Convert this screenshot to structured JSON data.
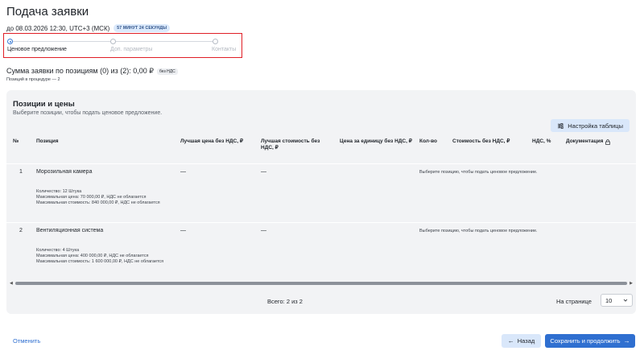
{
  "page": {
    "title": "Подача заявки",
    "deadline": "до 08.03.2026 12:30, UTC+3 (МСК)",
    "timer": "57 МИНУТ 24 СЕКУНДЫ"
  },
  "stepper": {
    "steps": [
      {
        "label": "Ценовое предложение",
        "active": true
      },
      {
        "label": "Доп. параметры",
        "active": false
      },
      {
        "label": "Контакты",
        "active": false
      }
    ]
  },
  "summary": {
    "text": "Сумма заявки по позициям (0) из (2): 0,00 ₽",
    "vat_badge": "без НДС",
    "positions_count": "Позиций в процедуре — 2"
  },
  "positions": {
    "title": "Позиции и цены",
    "subtitle": "Выберите позиции, чтобы подать ценовое предложение.",
    "settings_button": "Настройка таблицы",
    "columns": [
      "№",
      "Позиция",
      "Лучшая цена без НДС, ₽",
      "Лучшая стоимость без НДС, ₽",
      "Цена за единицу без НДС, ₽",
      "Кол-во",
      "Стоимость без НДС, ₽",
      "НДС, %",
      "Документация"
    ],
    "rows": [
      {
        "num": "1",
        "name": "Морозильная камера",
        "best_price": "—",
        "best_cost": "—",
        "hint": "Выберите позицию, чтобы подать ценовое предложение.",
        "details": [
          "Количество: 12 Штука",
          "Максимальная цена: 70 000,00 ₽, НДС не облагается",
          "Максимальная стоимость: 840 000,00 ₽, НДС не облагается"
        ]
      },
      {
        "num": "2",
        "name": "Вентиляционная система",
        "best_price": "—",
        "best_cost": "—",
        "hint": "Выберите позицию, чтобы подать ценовое предложение.",
        "details": [
          "Количество: 4 Штука",
          "Максимальная цена: 400 000,00 ₽, НДС не облагается",
          "Максимальная стоимость: 1 600 000,00 ₽, НДС не облагается"
        ]
      }
    ],
    "total": "Всего: 2 из 2",
    "per_page_label": "На странице",
    "per_page_value": "10"
  },
  "footer": {
    "cancel": "Отменить",
    "back": "Назад",
    "save": "Сохранить и продолжить"
  },
  "icons": {
    "settings": "sliders-icon",
    "lock": "lock-icon",
    "chevron": "chevron-down-icon",
    "back": "arrow-left-icon",
    "forward": "arrow-right-icon"
  },
  "colors": {
    "primary": "#2f6fd0",
    "highlight_border": "#e01e26",
    "card_bg": "#f2f3f5"
  }
}
